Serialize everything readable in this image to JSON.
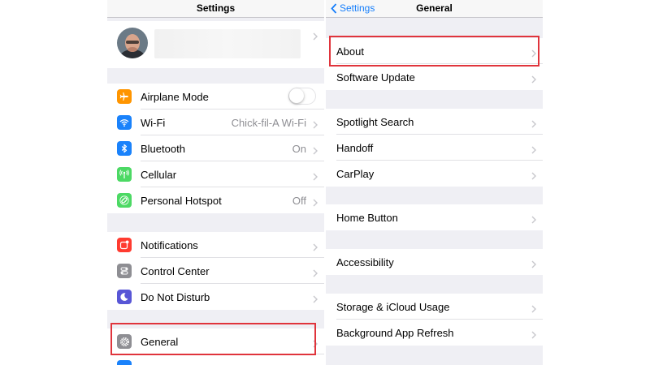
{
  "left": {
    "title": "Settings",
    "items": [
      {
        "label": "Airplane Mode"
      },
      {
        "label": "Wi-Fi",
        "value": "Chick-fil-A Wi-Fi"
      },
      {
        "label": "Bluetooth",
        "value": "On"
      },
      {
        "label": "Cellular"
      },
      {
        "label": "Personal Hotspot",
        "value": "Off"
      },
      {
        "label": "Notifications"
      },
      {
        "label": "Control Center"
      },
      {
        "label": "Do Not Disturb"
      },
      {
        "label": "General"
      }
    ],
    "airplane_toggle_on": false
  },
  "right": {
    "back_label": "Settings",
    "title": "General",
    "items": [
      {
        "label": "About"
      },
      {
        "label": "Software Update"
      },
      {
        "label": "Spotlight Search"
      },
      {
        "label": "Handoff"
      },
      {
        "label": "CarPlay"
      },
      {
        "label": "Home Button"
      },
      {
        "label": "Accessibility"
      },
      {
        "label": "Storage & iCloud Usage"
      },
      {
        "label": "Background App Refresh"
      }
    ]
  },
  "icons": {
    "airplane": "airplane-icon",
    "wifi": "wifi-icon",
    "bluetooth": "bluetooth-icon",
    "cellular": "cellular-icon",
    "hotspot": "hotspot-icon",
    "notifications": "notifications-icon",
    "control_center": "control-center-icon",
    "do_not_disturb": "moon-icon",
    "general": "gear-icon",
    "display": "display-icon"
  },
  "colors": {
    "highlight": "#e0343c",
    "ios_blue": "#157efb",
    "airplane": "#ff9500",
    "wifi": "#1a82fb",
    "bluetooth": "#1a82fb",
    "cellular": "#4cd964",
    "hotspot": "#4cd964",
    "notifications": "#ff3b30",
    "control_center": "#8e8e93",
    "do_not_disturb": "#5856d6",
    "general": "#8e8e93"
  }
}
